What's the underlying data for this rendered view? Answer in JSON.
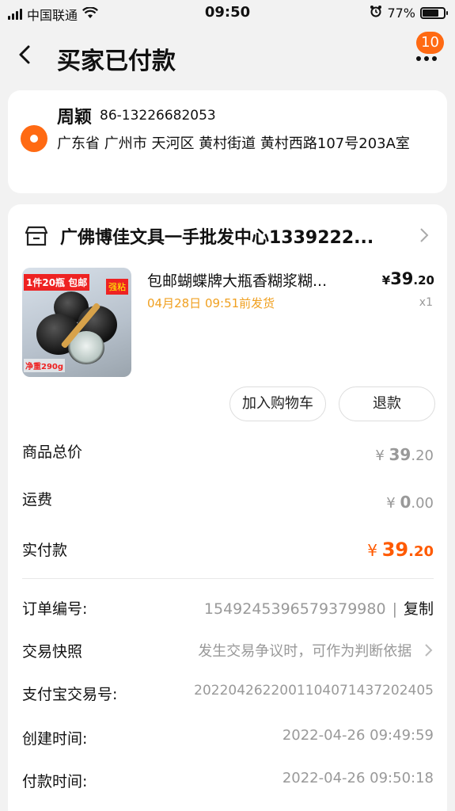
{
  "status_bar": {
    "carrier": "中国联通",
    "time": "09:50",
    "battery": "77%",
    "battery_level": 0.77
  },
  "nav": {
    "title": "买家已付款",
    "badge": "10"
  },
  "address": {
    "name": "周颖",
    "phone": "86-13226682053",
    "detail": "广东省 广州市 天河区 黄村街道 黄村西路107号203A室"
  },
  "shop": {
    "name": "广佛博佳文具一手批发中心1339222..."
  },
  "product": {
    "title": "包邮蝴蝶牌大瓶香糊浆糊...",
    "ship_time": "04月28日 09:51前发货",
    "price_symbol": "¥",
    "price_int": "39",
    "price_dec": ".20",
    "qty": "x1",
    "thumb_tag1": "1件20瓶 包邮",
    "thumb_tag2": "强粘",
    "thumb_foot": "净重290g"
  },
  "actions": {
    "add_cart": "加入购物车",
    "refund": "退款"
  },
  "summary": {
    "total_label": "商品总价",
    "total_int": "39",
    "total_dec": ".20",
    "shipping_label": "运费",
    "shipping_int": "0",
    "shipping_dec": ".00",
    "paid_label": "实付款",
    "paid_int": "39",
    "paid_dec": ".20",
    "currency": "¥"
  },
  "details": {
    "order_no_label": "订单编号:",
    "order_no": "1549245396579379980",
    "copy": "复制",
    "snapshot_label": "交易快照",
    "snapshot_text": "发生交易争议时，可作为判断依据",
    "alipay_label": "支付宝交易号:",
    "alipay_no": "2022042622001104071437202405",
    "created_label": "创建时间:",
    "created_time": "2022-04-26 09:49:59",
    "paid_time_label": "付款时间:",
    "paid_time": "2022-04-26 09:50:18"
  }
}
